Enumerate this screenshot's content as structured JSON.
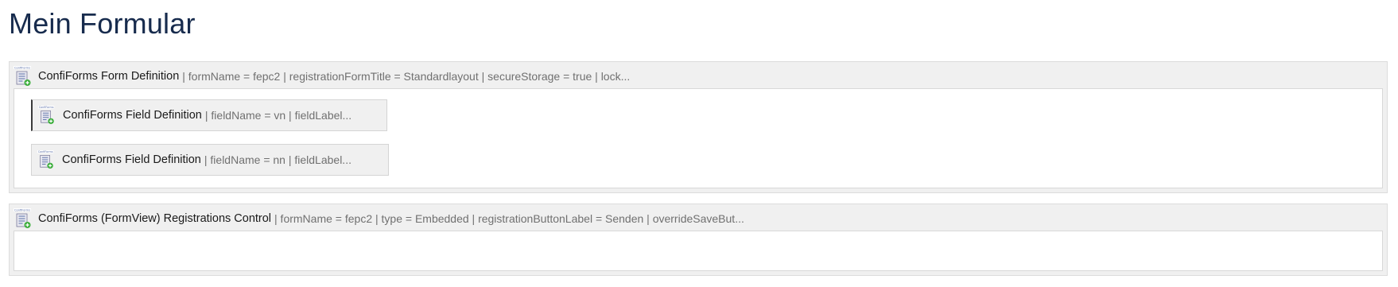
{
  "page": {
    "title": "Mein Formular"
  },
  "form_definition": {
    "name": "ConfiForms Form Definition",
    "params": "| formName = fepc2 | registrationFormTitle = Standardlayout | secureStorage = true | lock...",
    "icon": "confiforms-icon",
    "fields": [
      {
        "name": "ConfiForms Field Definition",
        "params": "| fieldName = vn | fieldLabel...",
        "icon": "confiforms-icon"
      },
      {
        "name": "ConfiForms Field Definition",
        "params": "| fieldName = nn | fieldLabel...",
        "icon": "confiforms-icon"
      }
    ]
  },
  "registrations_control": {
    "name": "ConfiForms (FormView) Registrations Control",
    "params": "| formName = fepc2 | type = Embedded | registrationButtonLabel = Senden | overrideSaveBut...",
    "icon": "confiforms-icon"
  },
  "colors": {
    "title": "#172b4d",
    "macro_bg": "#f0f0f0",
    "param_text": "#707070"
  }
}
